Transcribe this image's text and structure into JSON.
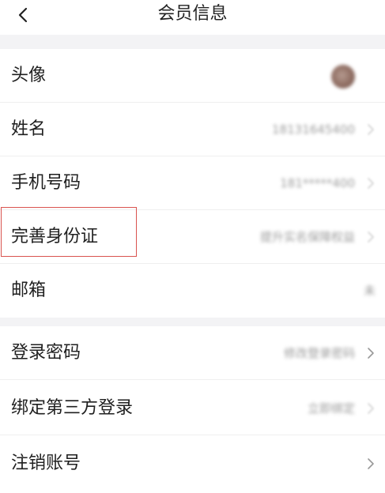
{
  "header": {
    "title": "会员信息"
  },
  "group1": [
    {
      "label": "头像",
      "value": ""
    },
    {
      "label": "姓名",
      "value": "18131645400"
    },
    {
      "label": "手机号码",
      "value": "181*****400"
    },
    {
      "label": "完善身份证",
      "value": "提升实名保障权益"
    },
    {
      "label": "邮箱",
      "value": "未"
    }
  ],
  "group2": [
    {
      "label": "登录密码",
      "value": "修改登录密码"
    },
    {
      "label": "绑定第三方登录",
      "value": "立即绑定"
    },
    {
      "label": "注销账号",
      "value": ""
    }
  ],
  "colors": {
    "highlight": "#d9534f",
    "background": "#f3f3f5"
  }
}
